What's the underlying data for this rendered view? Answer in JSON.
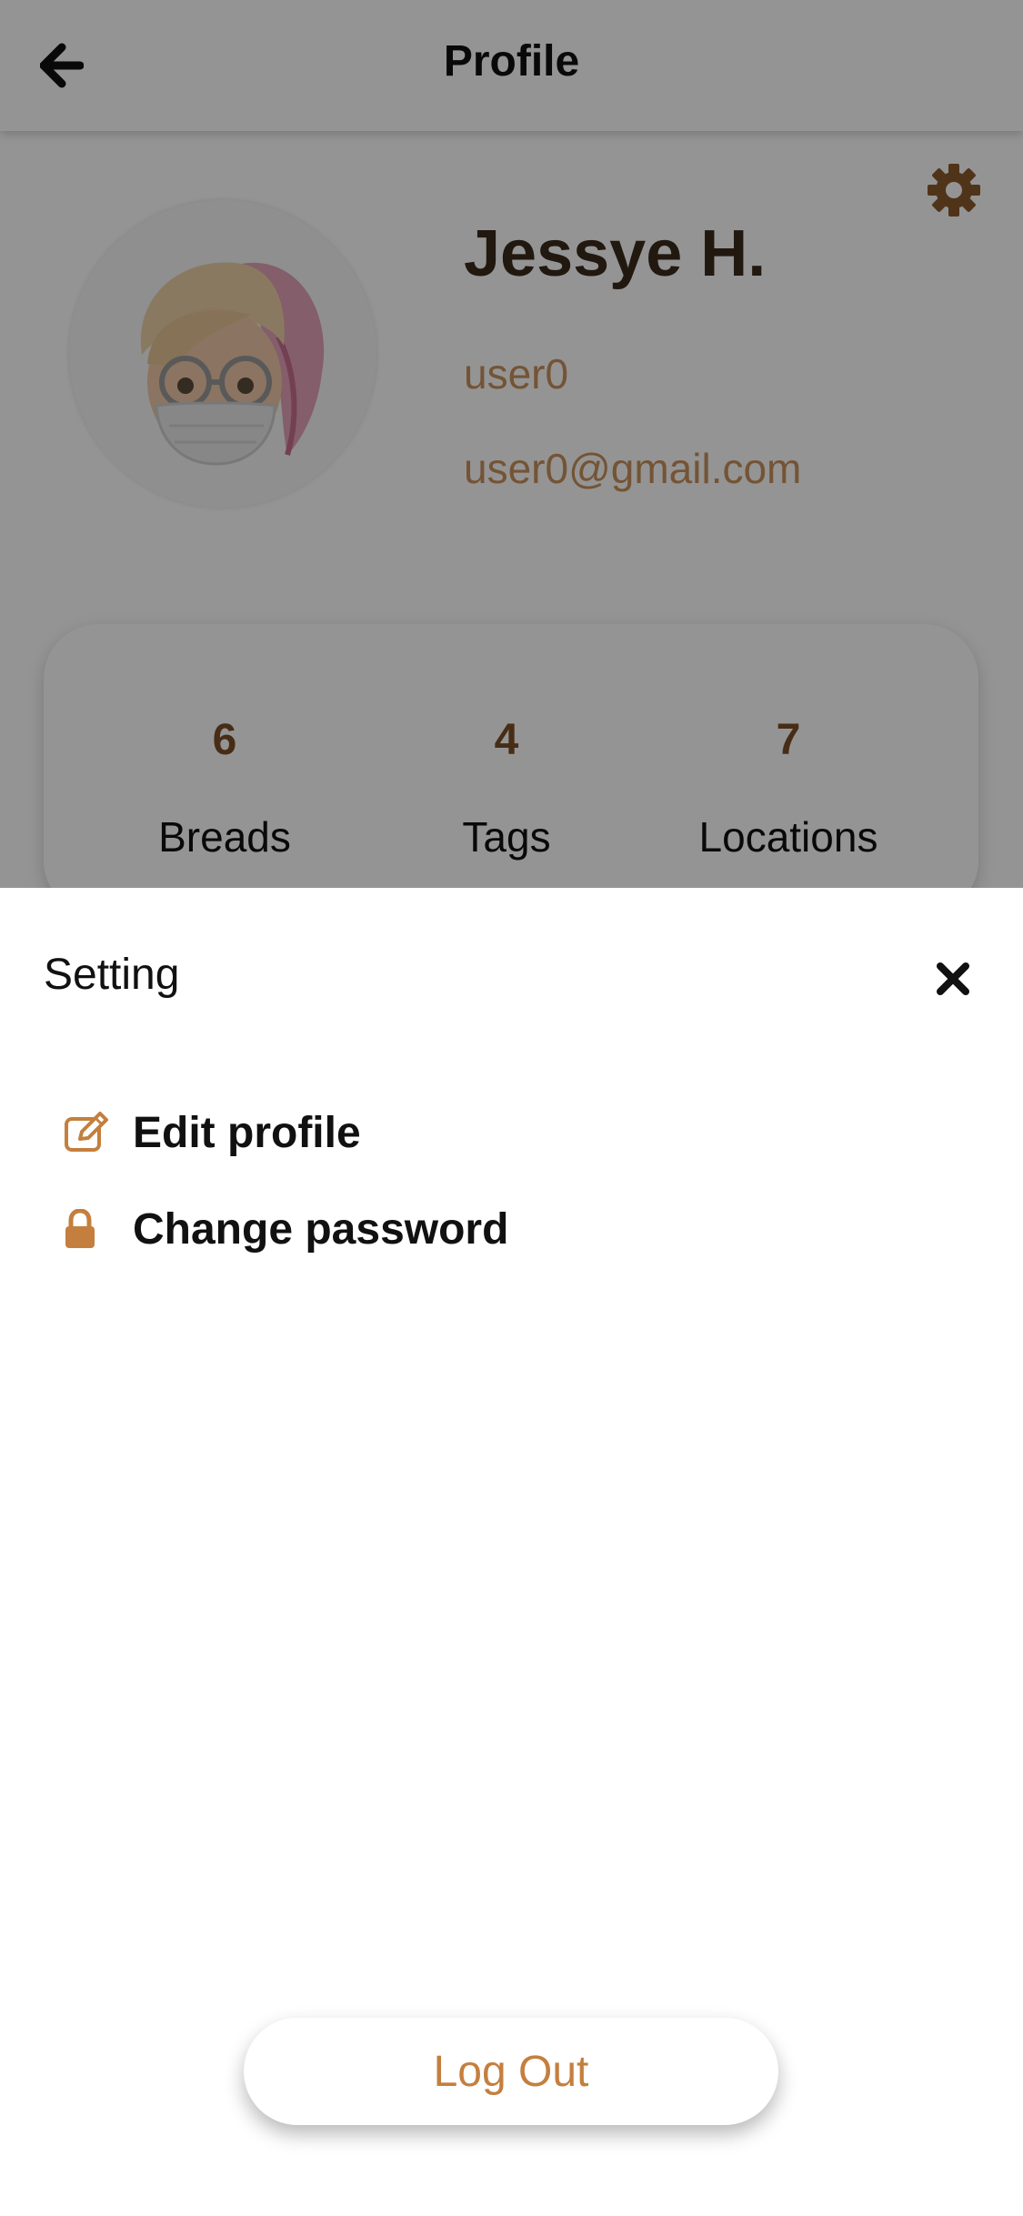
{
  "header": {
    "title": "Profile",
    "back_icon": "arrow-left-icon"
  },
  "profile": {
    "name": "Jessye H.",
    "username": "user0",
    "email": "user0@gmail.com",
    "settings_icon": "gear-icon"
  },
  "stats": [
    {
      "value": "6",
      "label": "Breads"
    },
    {
      "value": "4",
      "label": "Tags"
    },
    {
      "value": "7",
      "label": "Locations"
    }
  ],
  "sheet": {
    "title": "Setting",
    "close_icon": "close-icon",
    "items": [
      {
        "label": "Edit profile",
        "icon": "edit-icon"
      },
      {
        "label": "Change password",
        "icon": "lock-icon"
      }
    ],
    "logout_label": "Log Out"
  },
  "colors": {
    "accent": "#c47f3e",
    "muted_accent": "#c9915c",
    "dark_brown": "#3a2a1c",
    "overlay": "rgba(0,0,0,0.42)"
  }
}
